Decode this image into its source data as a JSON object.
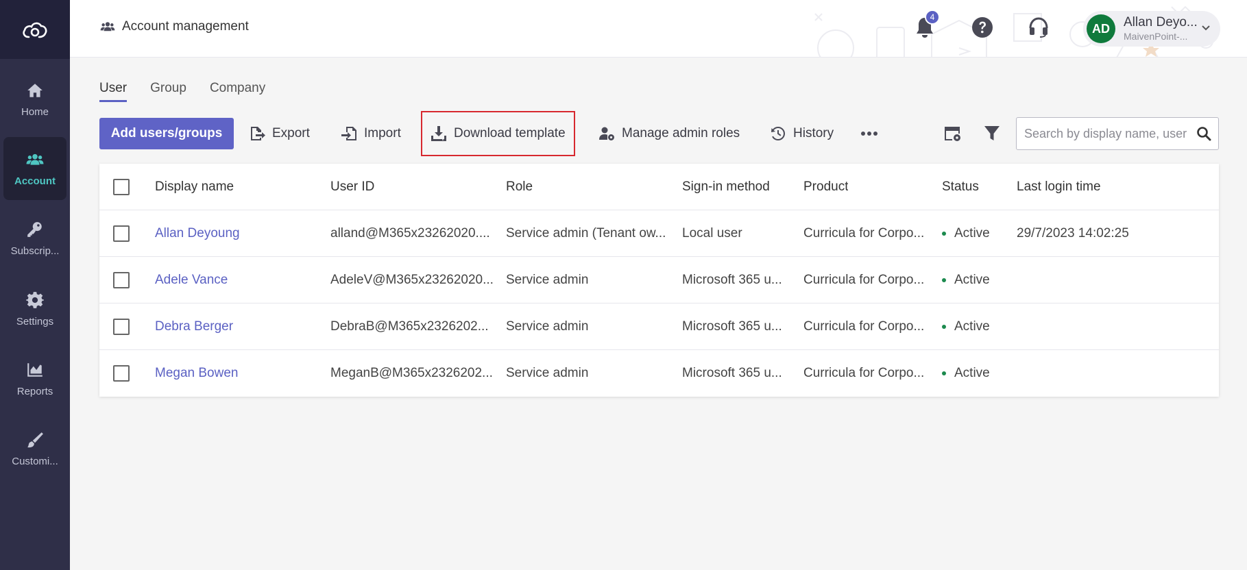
{
  "sidebar": {
    "items": [
      {
        "label": "Home",
        "icon": "home-icon"
      },
      {
        "label": "Account",
        "icon": "users-icon",
        "active": true
      },
      {
        "label": "Subscrip...",
        "icon": "key-icon"
      },
      {
        "label": "Settings",
        "icon": "gear-icon"
      },
      {
        "label": "Reports",
        "icon": "chart-icon"
      },
      {
        "label": "Customi...",
        "icon": "brush-icon"
      }
    ]
  },
  "header": {
    "title": "Account management",
    "notification_count": "4",
    "user": {
      "initials": "AD",
      "name": "Allan Deyo...",
      "org": "MaivenPoint-..."
    }
  },
  "tabs": [
    {
      "label": "User",
      "active": true
    },
    {
      "label": "Group"
    },
    {
      "label": "Company"
    }
  ],
  "toolbar": {
    "add_label": "Add users/groups",
    "export_label": "Export",
    "import_label": "Import",
    "download_label": "Download template",
    "manage_roles_label": "Manage admin roles",
    "history_label": "History",
    "search_placeholder": "Search by display name, user ID"
  },
  "table": {
    "columns": [
      "Display name",
      "User ID",
      "Role",
      "Sign-in method",
      "Product",
      "Status",
      "Last login time"
    ],
    "rows": [
      {
        "name": "Allan Deyoung",
        "user_id": "alland@M365x23262020....",
        "role": "Service admin (Tenant ow...",
        "signin": "Local user",
        "product": "Curricula for Corpo...",
        "status": "Active",
        "last_login": "29/7/2023 14:02:25"
      },
      {
        "name": "Adele Vance",
        "user_id": "AdeleV@M365x23262020...",
        "role": "Service admin",
        "signin": "Microsoft 365 u...",
        "product": "Curricula for Corpo...",
        "status": "Active",
        "last_login": ""
      },
      {
        "name": "Debra Berger",
        "user_id": "DebraB@M365x2326202...",
        "role": "Service admin",
        "signin": "Microsoft 365 u...",
        "product": "Curricula for Corpo...",
        "status": "Active",
        "last_login": ""
      },
      {
        "name": "Megan Bowen",
        "user_id": "MeganB@M365x2326202...",
        "role": "Service admin",
        "signin": "Microsoft 365 u...",
        "product": "Curricula for Corpo...",
        "status": "Active",
        "last_login": ""
      }
    ]
  },
  "colors": {
    "accent": "#5f63c6",
    "sidebar": "#2f2f48",
    "active_nav": "#4fc6c2",
    "status_active": "#1c8a4e",
    "avatar": "#0f7a3c",
    "highlight": "#d7282f"
  }
}
